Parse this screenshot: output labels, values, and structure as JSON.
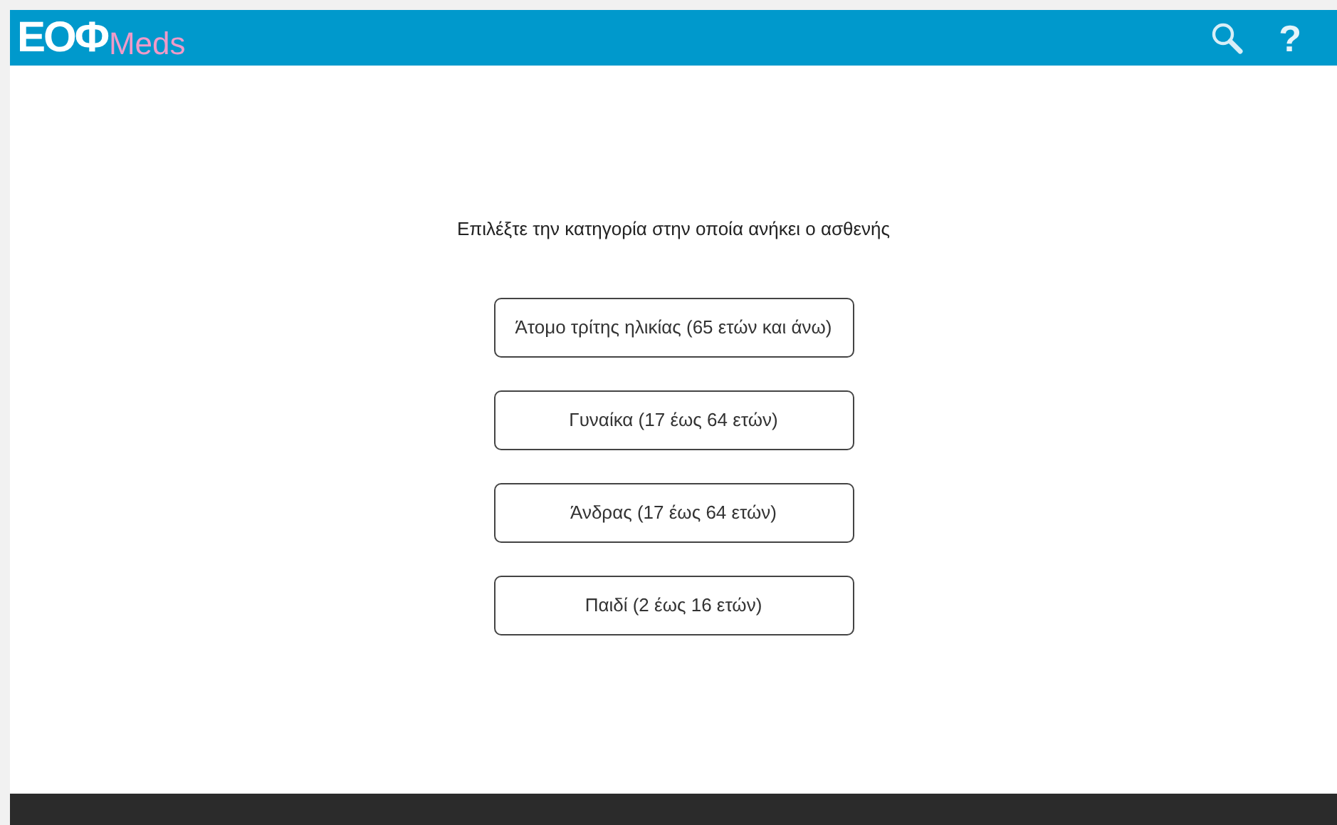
{
  "header": {
    "logo_main": "ΕΟΦ",
    "logo_sub": "Meds",
    "actions": [
      {
        "kind": "search"
      },
      {
        "kind": "help",
        "label": "?"
      }
    ]
  },
  "prompt": "Επιλέξτε την κατηγορία στην οποία ανήκει ο ασθενής",
  "options": [
    {
      "label": "Άτομο τρίτης ηλικίας (65 ετών και άνω)"
    },
    {
      "label": "Γυναίκα (17 έως 64 ετών)"
    },
    {
      "label": "Άνδρας (17 έως 64 ετών)"
    },
    {
      "label": "Παιδί (2 έως 16 ετών)"
    }
  ]
}
